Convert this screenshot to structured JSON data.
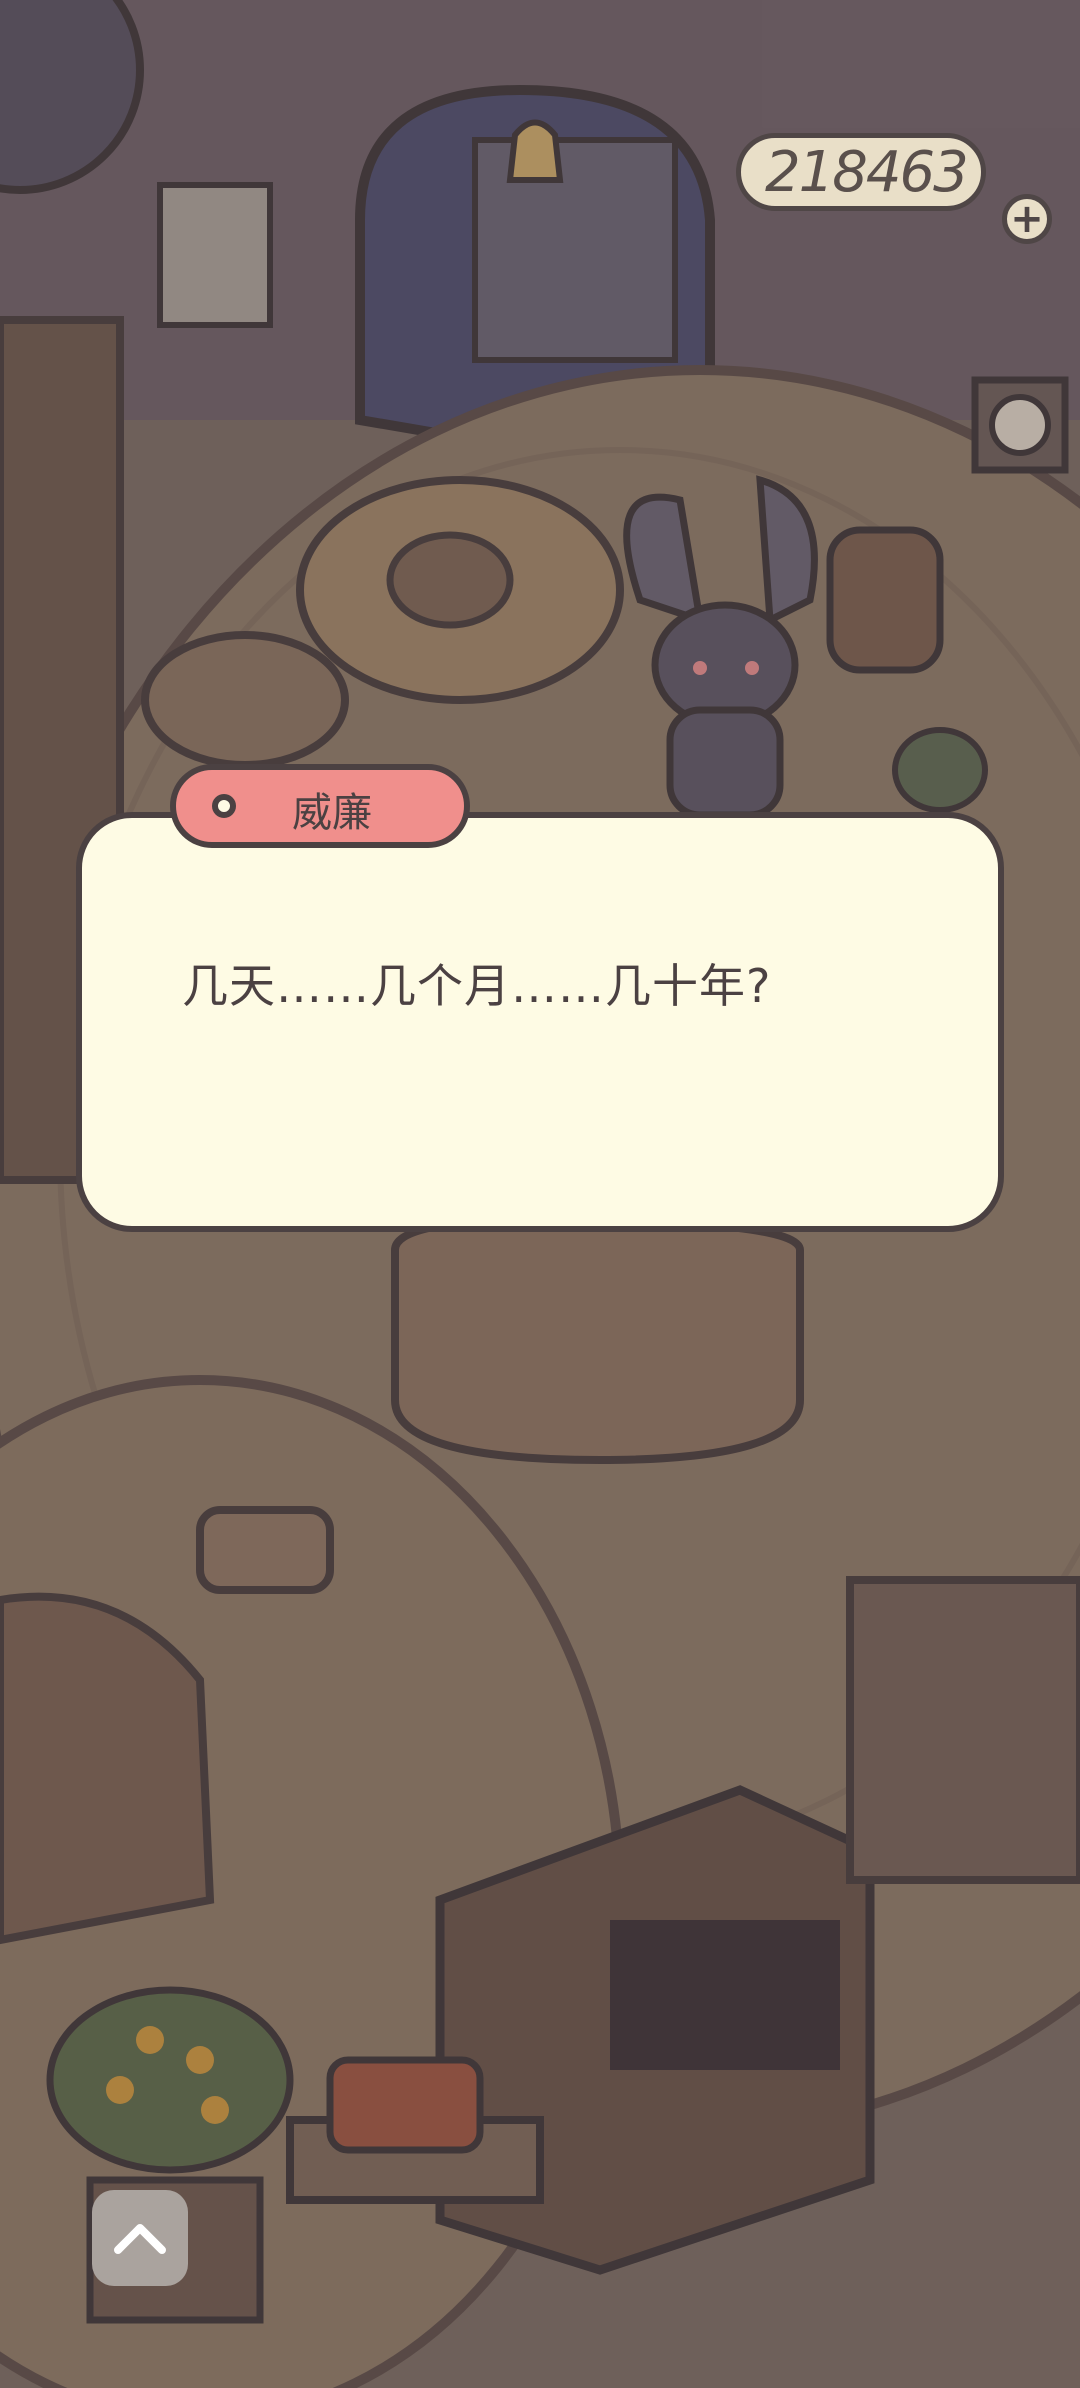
{
  "currency": {
    "amount": "218463",
    "add_icon": "plus-icon"
  },
  "dialog": {
    "speaker": "威廉",
    "text": "几天……几个月……几十年?"
  },
  "controls": {
    "expand_icon": "chevron-up-icon"
  },
  "colors": {
    "dialog_bg": "#fefbe4",
    "name_tag": "#f08f8c",
    "outline": "#4b4142"
  }
}
